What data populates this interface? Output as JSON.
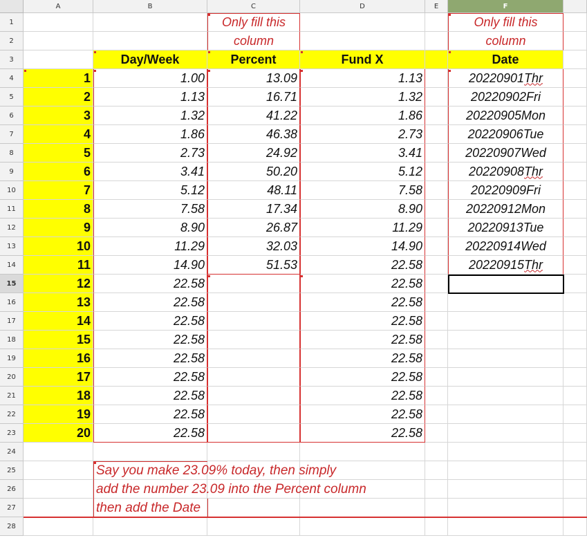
{
  "columns": [
    "A",
    "B",
    "C",
    "D",
    "E",
    "F"
  ],
  "rows": [
    "1",
    "2",
    "3",
    "4",
    "5",
    "6",
    "7",
    "8",
    "9",
    "10",
    "11",
    "12",
    "13",
    "14",
    "15",
    "16",
    "17",
    "18",
    "19",
    "20",
    "21",
    "22",
    "23",
    "24",
    "25",
    "26",
    "27",
    "28"
  ],
  "selected_cell": "F15",
  "accent_colors": {
    "highlight": "#ffff00",
    "note_red": "#c8282a",
    "selected_col": "#8fa870"
  },
  "headers": {
    "c_note_1": "Only fill this",
    "c_note_2": "column",
    "f_note_1": "Only fill this",
    "f_note_2": "column",
    "b": "Day/Week",
    "c": "Percent",
    "d": "Fund X",
    "f": "Date"
  },
  "day_week": [
    "1",
    "2",
    "3",
    "4",
    "5",
    "6",
    "7",
    "8",
    "9",
    "10",
    "11",
    "12",
    "13",
    "14",
    "15",
    "16",
    "17",
    "18",
    "19",
    "20"
  ],
  "col_b": [
    "1.00",
    "1.13",
    "1.32",
    "1.86",
    "2.73",
    "3.41",
    "5.12",
    "7.58",
    "8.90",
    "11.29",
    "14.90",
    "22.58",
    "22.58",
    "22.58",
    "22.58",
    "22.58",
    "22.58",
    "22.58",
    "22.58",
    "22.58"
  ],
  "percent": [
    "13.09",
    "16.71",
    "41.22",
    "46.38",
    "24.92",
    "50.20",
    "48.11",
    "17.34",
    "26.87",
    "32.03",
    "51.53"
  ],
  "fund_x": [
    "1.13",
    "1.32",
    "1.86",
    "2.73",
    "3.41",
    "5.12",
    "7.58",
    "8.90",
    "11.29",
    "14.90",
    "22.58",
    "22.58",
    "22.58",
    "22.58",
    "22.58",
    "22.58",
    "22.58",
    "22.58",
    "22.58",
    "22.58"
  ],
  "dates": [
    {
      "num": "20220901",
      "day": "Thr"
    },
    {
      "num": "20220902",
      "day": "Fri"
    },
    {
      "num": "20220905",
      "day": "Mon"
    },
    {
      "num": "20220906",
      "day": "Tue"
    },
    {
      "num": "20220907",
      "day": "Wed"
    },
    {
      "num": "20220908",
      "day": "Thr"
    },
    {
      "num": "20220909",
      "day": "Fri"
    },
    {
      "num": "20220912",
      "day": "Mon"
    },
    {
      "num": "20220913",
      "day": "Tue"
    },
    {
      "num": "20220914",
      "day": "Wed"
    },
    {
      "num": "20220915",
      "day": "Thr"
    }
  ],
  "note": {
    "line1": "Say you make 23.09% today, then simply",
    "line2": "add the number 23.09 into the Percent column",
    "line3": "then add the Date"
  }
}
